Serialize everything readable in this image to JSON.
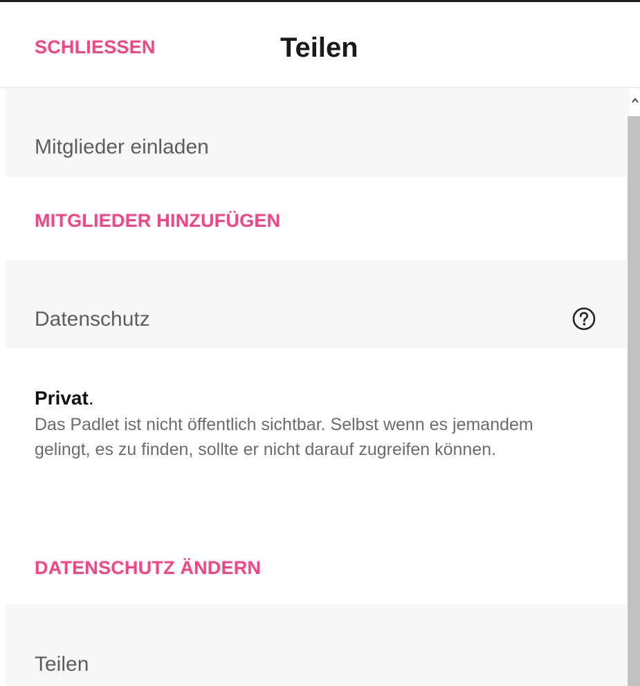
{
  "header": {
    "close_label": "SCHLIESSEN",
    "title": "Teilen"
  },
  "sections": {
    "invite": {
      "heading": "Mitglieder einladen",
      "action": "MITGLIEDER HINZUFÜGEN"
    },
    "privacy": {
      "heading": "Datenschutz",
      "help_icon": "help-circle-icon",
      "status_title": "Privat",
      "status_suffix": ".",
      "description": "Das Padlet ist nicht öffentlich sichtbar. Selbst wenn es jemandem gelingt, es zu finden, sollte er nicht darauf zugreifen können.",
      "action": "DATENSCHUTZ ÄNDERN"
    },
    "share": {
      "heading": "Teilen"
    }
  },
  "colors": {
    "accent": "#ff4081",
    "section_bg": "#f7f7f7",
    "heading_text": "#5d5d5d"
  }
}
